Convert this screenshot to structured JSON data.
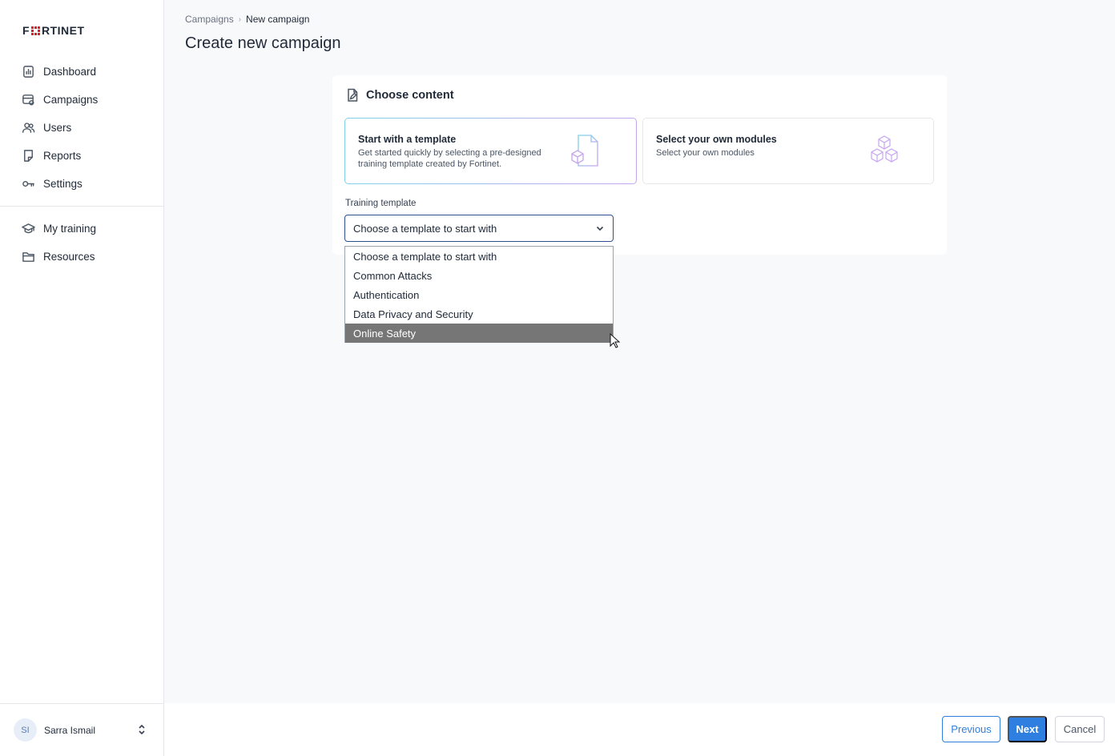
{
  "brand": {
    "logo_text": "FORTINET",
    "accent": "#d81f26"
  },
  "sidebar": {
    "items": [
      {
        "label": "Dashboard",
        "icon": "dashboard-icon"
      },
      {
        "label": "Campaigns",
        "icon": "campaigns-icon"
      },
      {
        "label": "Users",
        "icon": "users-icon"
      },
      {
        "label": "Reports",
        "icon": "reports-icon"
      },
      {
        "label": "Settings",
        "icon": "settings-icon"
      }
    ],
    "secondary_items": [
      {
        "label": "My training",
        "icon": "graduation-cap-icon"
      },
      {
        "label": "Resources",
        "icon": "folder-icon"
      }
    ],
    "user": {
      "initials": "SI",
      "name": "Sarra Ismail"
    }
  },
  "breadcrumb": {
    "parent": "Campaigns",
    "current": "New campaign"
  },
  "page": {
    "title": "Create new campaign"
  },
  "content_card": {
    "title": "Choose content",
    "options": [
      {
        "title": "Start with a template",
        "description": "Get started quickly by selecting a pre-designed training template created by Fortinet.",
        "selected": true
      },
      {
        "title": "Select your own modules",
        "description": "Select your own modules",
        "selected": false
      }
    ]
  },
  "training_template": {
    "label": "Training template",
    "selected_value": "Choose a template to start with",
    "options": [
      "Choose a template to start with",
      "Common Attacks",
      "Authentication",
      "Data Privacy and Security",
      "Online Safety"
    ],
    "highlighted": "Online Safety"
  },
  "footer": {
    "previous_label": "Previous",
    "next_label": "Next",
    "cancel_label": "Cancel"
  },
  "colors": {
    "primary": "#2f7fe0",
    "focus_border": "#2f4f8f",
    "highlight": "#767676"
  }
}
